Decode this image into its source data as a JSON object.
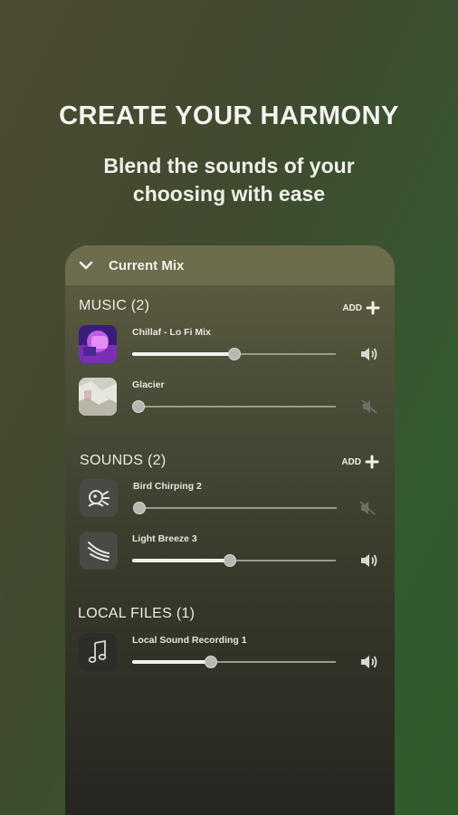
{
  "hero": {
    "title": "CREATE YOUR HARMONY",
    "subtitle_line1": "Blend the sounds of your",
    "subtitle_line2": "choosing with ease"
  },
  "panel": {
    "header_title": "Current Mix",
    "add_label": "ADD"
  },
  "sections": {
    "music": {
      "title": "MUSIC (2)",
      "items": [
        {
          "name": "Chillaf - Lo Fi Mix",
          "volume": 0.5,
          "muted": false
        },
        {
          "name": "Glacier",
          "volume": 0.0,
          "muted": true
        }
      ]
    },
    "sounds": {
      "title": "SOUNDS (2)",
      "items": [
        {
          "name": "Bird Chirping 2",
          "volume": 0.0,
          "muted": true
        },
        {
          "name": "Light Breeze 3",
          "volume": 0.48,
          "muted": false
        }
      ]
    },
    "local": {
      "title": "LOCAL FILES (1)",
      "items": [
        {
          "name": "Local Sound Recording 1",
          "volume": 0.38,
          "muted": false
        }
      ]
    }
  },
  "colors": {
    "header_bg": "#6d6c4c",
    "accent_white": "#f2f2ec"
  },
  "icons": {
    "collapse": "chevron-down-icon",
    "add": "plus-icon",
    "volume_on": "speaker-on-icon",
    "volume_off": "speaker-muted-icon",
    "bird": "bird-icon",
    "wind": "wind-icon",
    "music_note": "music-note-icon"
  }
}
